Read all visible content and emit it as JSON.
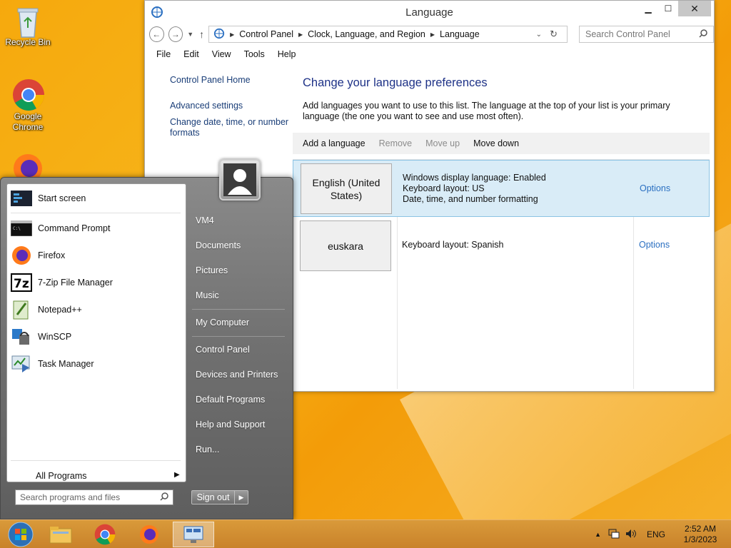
{
  "desktop": {
    "icons": [
      {
        "label": "Recycle Bin",
        "icon": "recycle-bin-icon"
      },
      {
        "label": "Google Chrome",
        "icon": "chrome-icon"
      },
      {
        "label": "",
        "icon": "firefox-icon"
      }
    ]
  },
  "window": {
    "title": "Language",
    "close_glyph": "✕",
    "address": {
      "crumbs": [
        "Control Panel",
        "Clock, Language, and Region",
        "Language"
      ]
    },
    "search_placeholder": "Search Control Panel",
    "menu": [
      "File",
      "Edit",
      "View",
      "Tools",
      "Help"
    ],
    "left_pane": {
      "home": "Control Panel Home",
      "advanced": "Advanced settings",
      "change_date": "Change date, time, or number formats"
    },
    "heading": "Change your language preferences",
    "description": "Add languages you want to use to this list. The language at the top of your list is your primary language (the one you want to see and use most often).",
    "toolbar": {
      "add": "Add a language",
      "remove": "Remove",
      "move_up": "Move up",
      "move_down": "Move down"
    },
    "languages": [
      {
        "name": "English (United States)",
        "info": [
          "Windows display language: Enabled",
          "Keyboard layout: US",
          "Date, time, and number formatting"
        ],
        "options": "Options",
        "selected": true
      },
      {
        "name": "euskara",
        "info": [
          "Keyboard layout: Spanish"
        ],
        "options": "Options",
        "selected": false
      }
    ]
  },
  "start_menu": {
    "programs": [
      {
        "label": "Start screen",
        "icon": "start-screen-icon"
      },
      {
        "label": "Command Prompt",
        "icon": "command-prompt-icon"
      },
      {
        "label": "Firefox",
        "icon": "firefox-icon"
      },
      {
        "label": "7-Zip File Manager",
        "icon": "7zip-icon"
      },
      {
        "label": "Notepad++",
        "icon": "notepadpp-icon"
      },
      {
        "label": "WinSCP",
        "icon": "winscp-icon"
      },
      {
        "label": "Task Manager",
        "icon": "task-manager-icon"
      }
    ],
    "all_programs": "All Programs",
    "search_placeholder": "Search programs and files",
    "right_links": {
      "user": "VM4",
      "documents": "Documents",
      "pictures": "Pictures",
      "music": "Music",
      "my_computer": "My Computer",
      "control_panel": "Control Panel",
      "devices": "Devices and Printers",
      "default_programs": "Default Programs",
      "help": "Help and Support",
      "run": "Run..."
    },
    "sign_out": "Sign out"
  },
  "taskbar": {
    "language": "ENG",
    "time": "2:52 AM",
    "date": "1/3/2023"
  }
}
